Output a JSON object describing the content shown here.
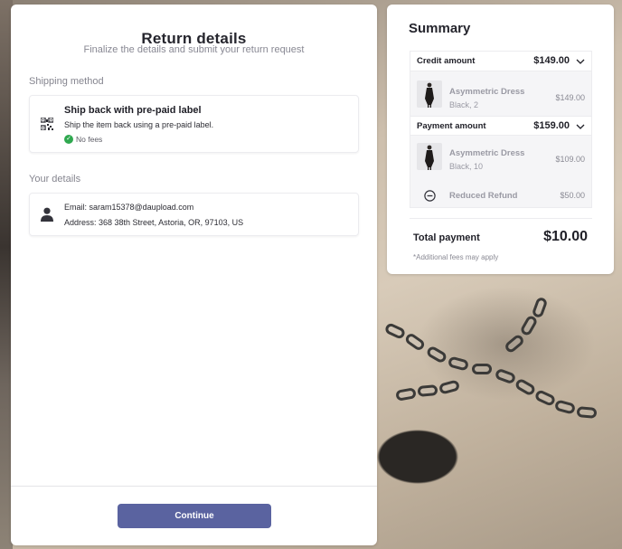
{
  "return_details": {
    "title": "Return details",
    "subtitle": "Finalize the details and submit your return request",
    "shipping_label": "Shipping method",
    "shipping": {
      "title": "Ship back with pre-paid label",
      "description": "Ship the item back using a pre-paid label.",
      "fees": "No fees",
      "icon": "qr-code-icon"
    },
    "details_label": "Your details",
    "details": {
      "email": "Email: saram15378@daupload.com",
      "address": "Address: 368 38th Street, Astoria, OR, 97103, US",
      "icon": "person-icon"
    },
    "continue_label": "Continue"
  },
  "summary": {
    "title": "Summary",
    "credit": {
      "label": "Credit amount",
      "amount": "$149.00",
      "items": [
        {
          "name": "Asymmetric Dress",
          "variant": "Black, 2",
          "price": "$149.00"
        }
      ]
    },
    "payment": {
      "label": "Payment amount",
      "amount": "$159.00",
      "items": [
        {
          "name": "Asymmetric Dress",
          "variant": "Black, 10",
          "price": "$109.00"
        }
      ],
      "refund": {
        "label": "Reduced Refund",
        "amount": "$50.00"
      }
    },
    "total_label": "Total payment",
    "total_amount": "$10.00",
    "fees_note": "*Additional fees may apply"
  },
  "colors": {
    "accent": "#5a63a0",
    "success": "#2fa84f"
  }
}
